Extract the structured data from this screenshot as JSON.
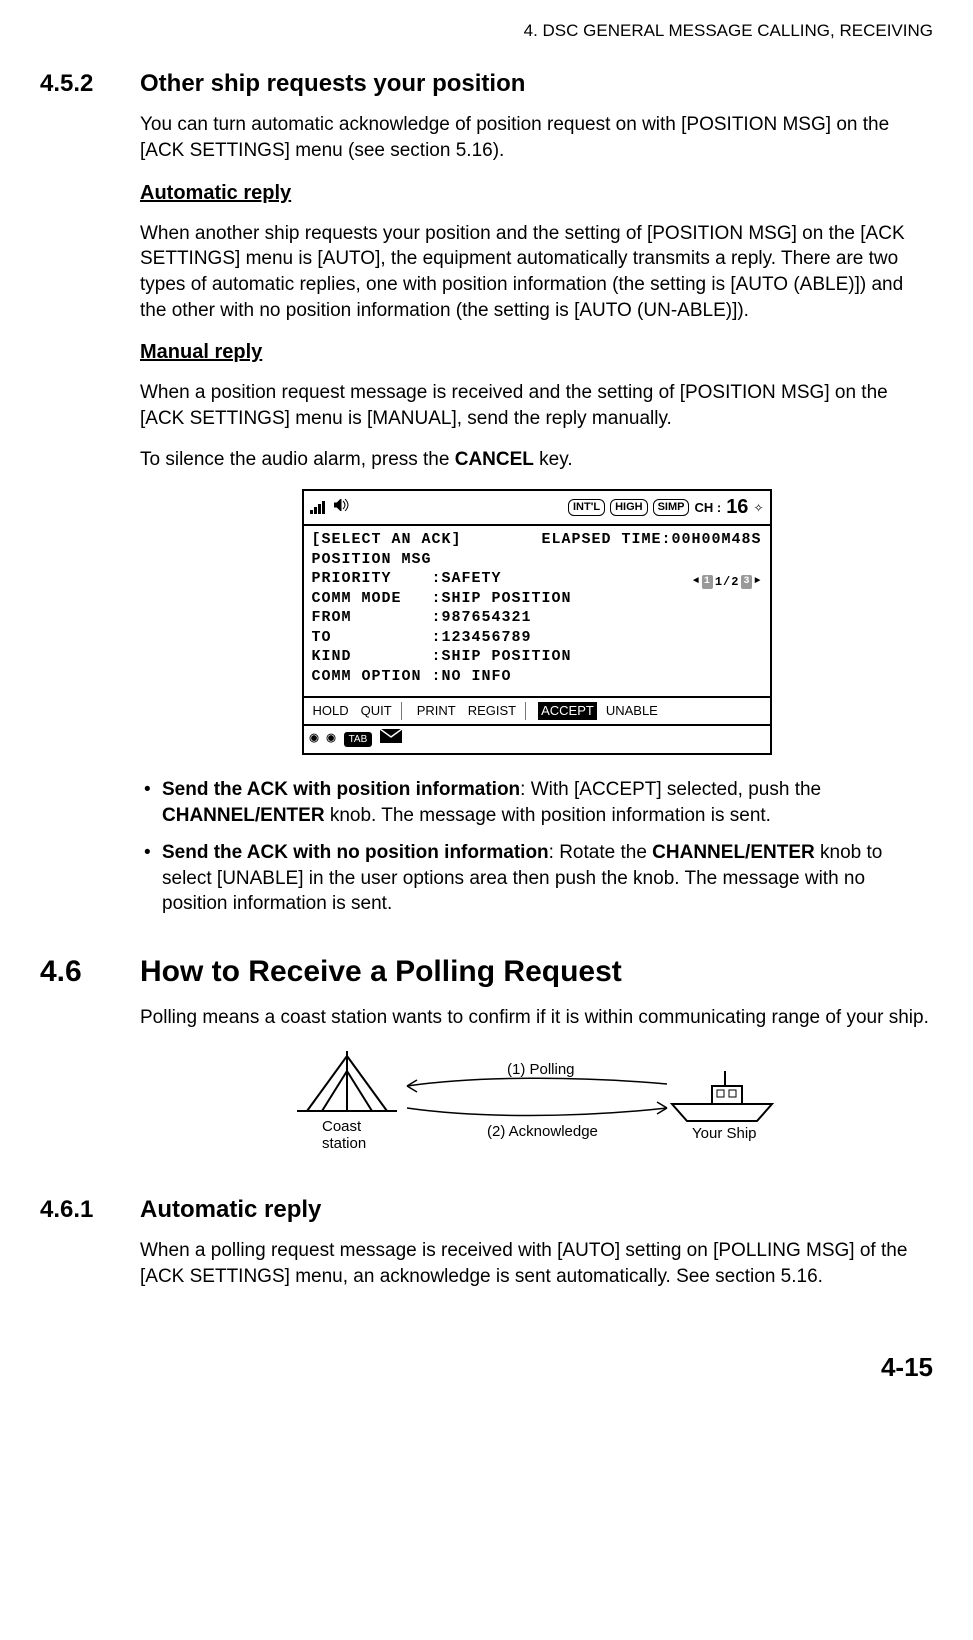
{
  "header": "4.  DSC GENERAL MESSAGE CALLING, RECEIVING",
  "s452": {
    "num": "4.5.2",
    "title": "Other ship requests your position",
    "intro": "You can turn automatic acknowledge of position request on with [POSITION MSG] on the [ACK SETTINGS] menu (see section 5.16).",
    "auto_head": "Automatic reply",
    "auto_para": "When another ship requests your position and the setting of [POSITION MSG] on the [ACK SETTINGS] menu is [AUTO], the equipment automatically transmits a reply. There are two types of automatic replies, one with position information (the setting is [AUTO (ABLE)]) and the other with no position information (the setting is [AUTO (UN-ABLE)]).",
    "manual_head": "Manual reply",
    "manual_para_1": "When a position request message is received and the setting of [POSITION MSG] on the [ACK SETTINGS] menu is [MANUAL], send the reply manually.",
    "manual_para_2a": "To silence the audio alarm, press the ",
    "manual_para_2b": "CANCEL",
    "manual_para_2c": " key."
  },
  "screen": {
    "pills": {
      "intl": "INT'L",
      "high": "HIGH",
      "simp": "SIMP"
    },
    "ch_label": "CH :",
    "ch_num": "16",
    "line1_left": "[SELECT AN ACK]",
    "line1_right": "ELAPSED TIME:00H00M48S",
    "line2": "POSITION MSG",
    "line3": "PRIORITY    :SAFETY",
    "line4": "COMM MODE   :SHIP POSITION",
    "line5": "FROM        :987654321",
    "line6": "TO          :123456789",
    "line7": "KIND        :SHIP POSITION",
    "line8": "COMM OPTION :NO INFO",
    "page_ind": "1/2",
    "menu": {
      "hold": "HOLD",
      "quit": "QUIT",
      "print": "PRINT",
      "regist": "REGIST",
      "accept": "ACCEPT",
      "unable": "UNABLE"
    },
    "tab": "TAB"
  },
  "bullets": {
    "b1_a": "Send the ACK with position information",
    "b1_b": ": With [ACCEPT] selected, push the ",
    "b1_c": "CHANNEL/ENTER",
    "b1_d": " knob. The message with position information is sent.",
    "b2_a": "Send the ACK with no position information",
    "b2_b": ": Rotate the ",
    "b2_c": "CHANNEL/ENTER",
    "b2_d": " knob to select [UNABLE] in the user options area then push the knob. The message with no position information is sent."
  },
  "s46": {
    "num": "4.6",
    "title": "How to Receive a Polling Request",
    "para": "Polling means a coast station wants to confirm if it is within communicating range of your ship."
  },
  "diagram": {
    "coast": "Coast\nstation",
    "polling": "(1) Polling",
    "ack": "(2) Acknowledge",
    "ship": "Your Ship"
  },
  "s461": {
    "num": "4.6.1",
    "title": "Automatic reply",
    "para": "When a polling request message is received with [AUTO] setting on [POLLING MSG] of the [ACK SETTINGS] menu, an acknowledge is sent automatically. See section 5.16."
  },
  "pagenum": "4-15"
}
